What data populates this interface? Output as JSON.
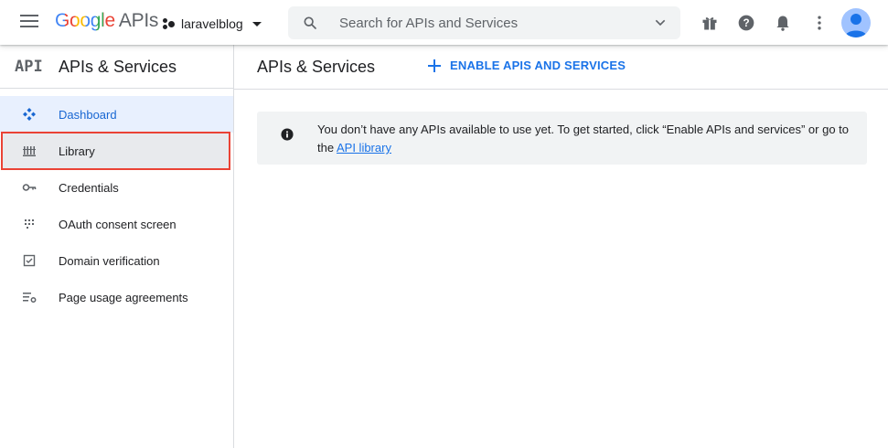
{
  "header": {
    "logo_google": "Google",
    "logo_apis": "APIs",
    "project_name": "laravelblog",
    "search_placeholder": "Search for APIs and Services",
    "icons": [
      "menu-icon",
      "project-icon",
      "dropdown-caret-icon",
      "search-icon",
      "chevron-down-icon",
      "gift-icon",
      "help-icon",
      "notifications-icon",
      "more-vert-icon",
      "avatar"
    ]
  },
  "sidebar": {
    "logo_text": "API",
    "title": "APIs & Services",
    "items": [
      {
        "label": "Dashboard",
        "icon": "dashboard-icon",
        "state": "active"
      },
      {
        "label": "Library",
        "icon": "library-icon",
        "state": "highlighted"
      },
      {
        "label": "Credentials",
        "icon": "key-icon"
      },
      {
        "label": "OAuth consent screen",
        "icon": "oauth-icon"
      },
      {
        "label": "Domain verification",
        "icon": "checkbox-icon"
      },
      {
        "label": "Page usage agreements",
        "icon": "settings-list-icon"
      }
    ]
  },
  "main": {
    "title": "APIs & Services",
    "enable_button": "ENABLE APIS AND SERVICES",
    "notice": {
      "text": "You don’t have any APIs available to use yet. To get started, click “Enable APIs and services” or go to the",
      "link": "API library"
    }
  },
  "colors": {
    "accent": "#1a73e8",
    "active_bg": "#e8f0fe",
    "highlight_outline": "#ea4335",
    "notice_bg": "#f1f3f4"
  }
}
